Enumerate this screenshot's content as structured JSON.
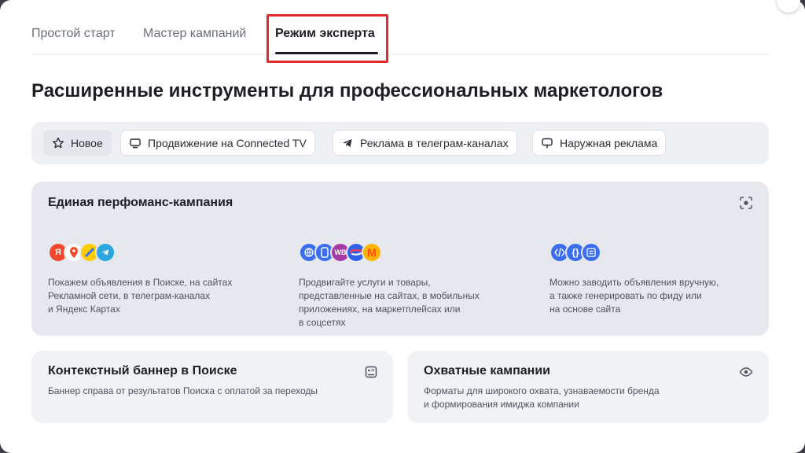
{
  "tabs": [
    {
      "label": "Простой старт"
    },
    {
      "label": "Мастер кампаний"
    },
    {
      "label": "Режим эксперта"
    }
  ],
  "title": "Расширенные инструменты для профессиональных маркетологов",
  "chips": [
    {
      "label": "Новое",
      "icon": "star-icon"
    },
    {
      "label": "Продвижение на Connected TV",
      "icon": "tv-icon"
    },
    {
      "label": "Реклама в телеграм-каналах",
      "icon": "telegram-icon"
    },
    {
      "label": "Наружная реклама",
      "icon": "billboard-icon"
    }
  ],
  "performance_card": {
    "title": "Единая перфоманс-кампания",
    "columns": [
      {
        "logos": [
          "Я",
          "pin",
          "bee",
          "tg"
        ],
        "lines": [
          "Покажем объявления в Поиске, на сайтах",
          "Рекламной сети, в телеграм-каналах",
          "и Яндекс Картах"
        ]
      },
      {
        "logos": [
          "globe",
          "phone",
          "WB",
          "ozon",
          "M"
        ],
        "lines": [
          "Продвигайте услуги и товары,",
          "представленные на сайтах, в мобильных",
          "приложениях, на маркетплейсах или",
          "в соцсетях"
        ]
      },
      {
        "logos": [
          "code",
          "braces",
          "list"
        ],
        "lines": [
          "Можно заводить объявления вручную,",
          "а также генерировать по фиду или",
          "на основе сайта"
        ]
      }
    ]
  },
  "context_banner_card": {
    "title": "Контекстный баннер в Поиске",
    "lines": [
      "Баннер справа от результатов Поиска с оплатой за переходы"
    ]
  },
  "reach_card": {
    "title": "Охватные кампании",
    "lines": [
      "Форматы для широкого охвата, узнаваемости бренда",
      "и формирования имиджа компании"
    ]
  },
  "colors": {
    "highlight": "#e02a2a",
    "accent_blue": "#3a6df0",
    "card_bg": "#e6e8ee"
  }
}
